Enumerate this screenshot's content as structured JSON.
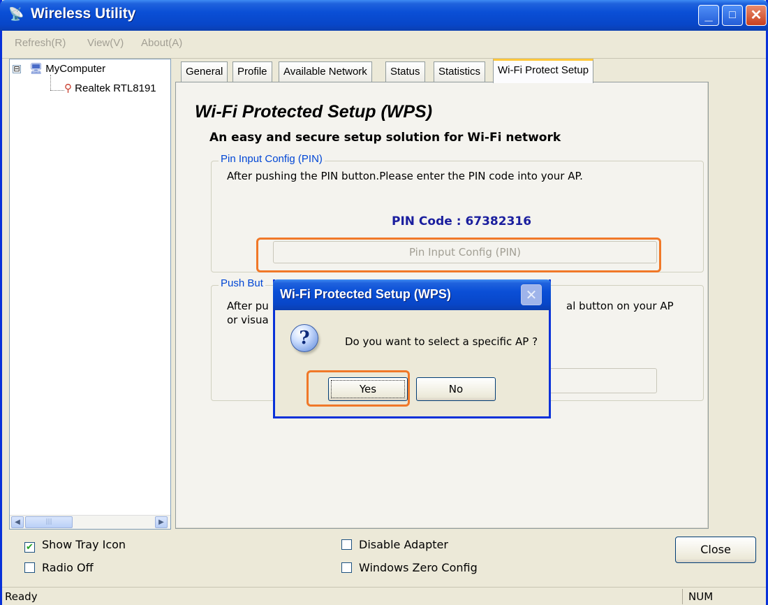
{
  "window": {
    "title": "Wireless Utility",
    "controls": {
      "minimize": "_",
      "maximize": "□",
      "close": "✕"
    }
  },
  "menu": [
    "Refresh(R)",
    "View(V)",
    "About(A)"
  ],
  "tree": {
    "root": "MyComputer",
    "child": "Realtek RTL8191",
    "expander": "⊟"
  },
  "tabs": [
    "General",
    "Profile",
    "Available Network",
    "Status",
    "Statistics",
    "Wi-Fi Protect Setup"
  ],
  "active_tab": "Wi-Fi Protect Setup",
  "wps": {
    "title": "Wi-Fi Protected Setup (WPS)",
    "subtitle": "An easy and secure setup solution for Wi-Fi network",
    "pin_group": {
      "legend": "Pin Input Config (PIN)",
      "text": "After pushing the PIN button.Please enter the PIN code into your AP.",
      "pin_label": "PIN Code :",
      "pin_value": "67382316",
      "button": "Pin Input Config (PIN)"
    },
    "push_group": {
      "legend": "Push But",
      "text_left_1": "After pu",
      "text_left_2": "or visua",
      "text_right": "al button on your AP"
    }
  },
  "bottom": {
    "show_tray_icon": {
      "label": "Show Tray Icon",
      "checked": true
    },
    "radio_off": {
      "label": "Radio Off",
      "checked": false
    },
    "disable_adapter": {
      "label": "Disable Adapter",
      "checked": false
    },
    "windows_zero_config": {
      "label": "Windows Zero Config",
      "checked": false
    },
    "close": "Close"
  },
  "status": {
    "text": "Ready",
    "num": "NUM"
  },
  "dialog": {
    "title": "Wi-Fi Protected Setup (WPS)",
    "icon": "?",
    "message": "Do you want to select a specific AP ?",
    "yes": "Yes",
    "no": "No"
  },
  "colors": {
    "highlight": "#f07828",
    "titlebar": "#0a4fd6",
    "pin_code": "#1a1e9e",
    "group_legend": "#0046d5"
  }
}
